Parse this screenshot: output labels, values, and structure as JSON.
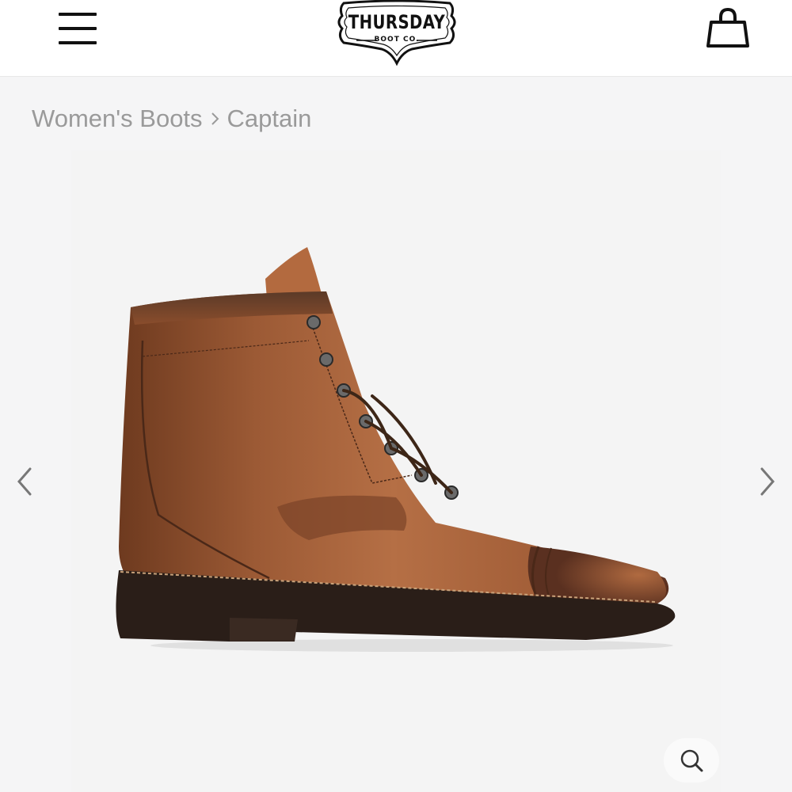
{
  "header": {
    "menu_icon": "hamburger-menu-icon",
    "logo": {
      "line1": "THURSDAY",
      "line2": "BOOT CO."
    },
    "cart_icon": "shopping-bag-icon"
  },
  "breadcrumb": {
    "items": [
      "Women's Boots",
      "Captain"
    ],
    "separator_icon": "chevron-right-icon"
  },
  "gallery": {
    "image": "brown-leather-captain-lace-up-boot",
    "prev_icon": "chevron-left-icon",
    "next_icon": "chevron-right-icon",
    "zoom_icon": "magnifier-icon"
  },
  "colors": {
    "background": "#f5f5f6",
    "header": "#ffffff",
    "breadcrumb_text": "#9a9a9a",
    "leather": "#9a5230",
    "sole": "#2a1e18"
  }
}
